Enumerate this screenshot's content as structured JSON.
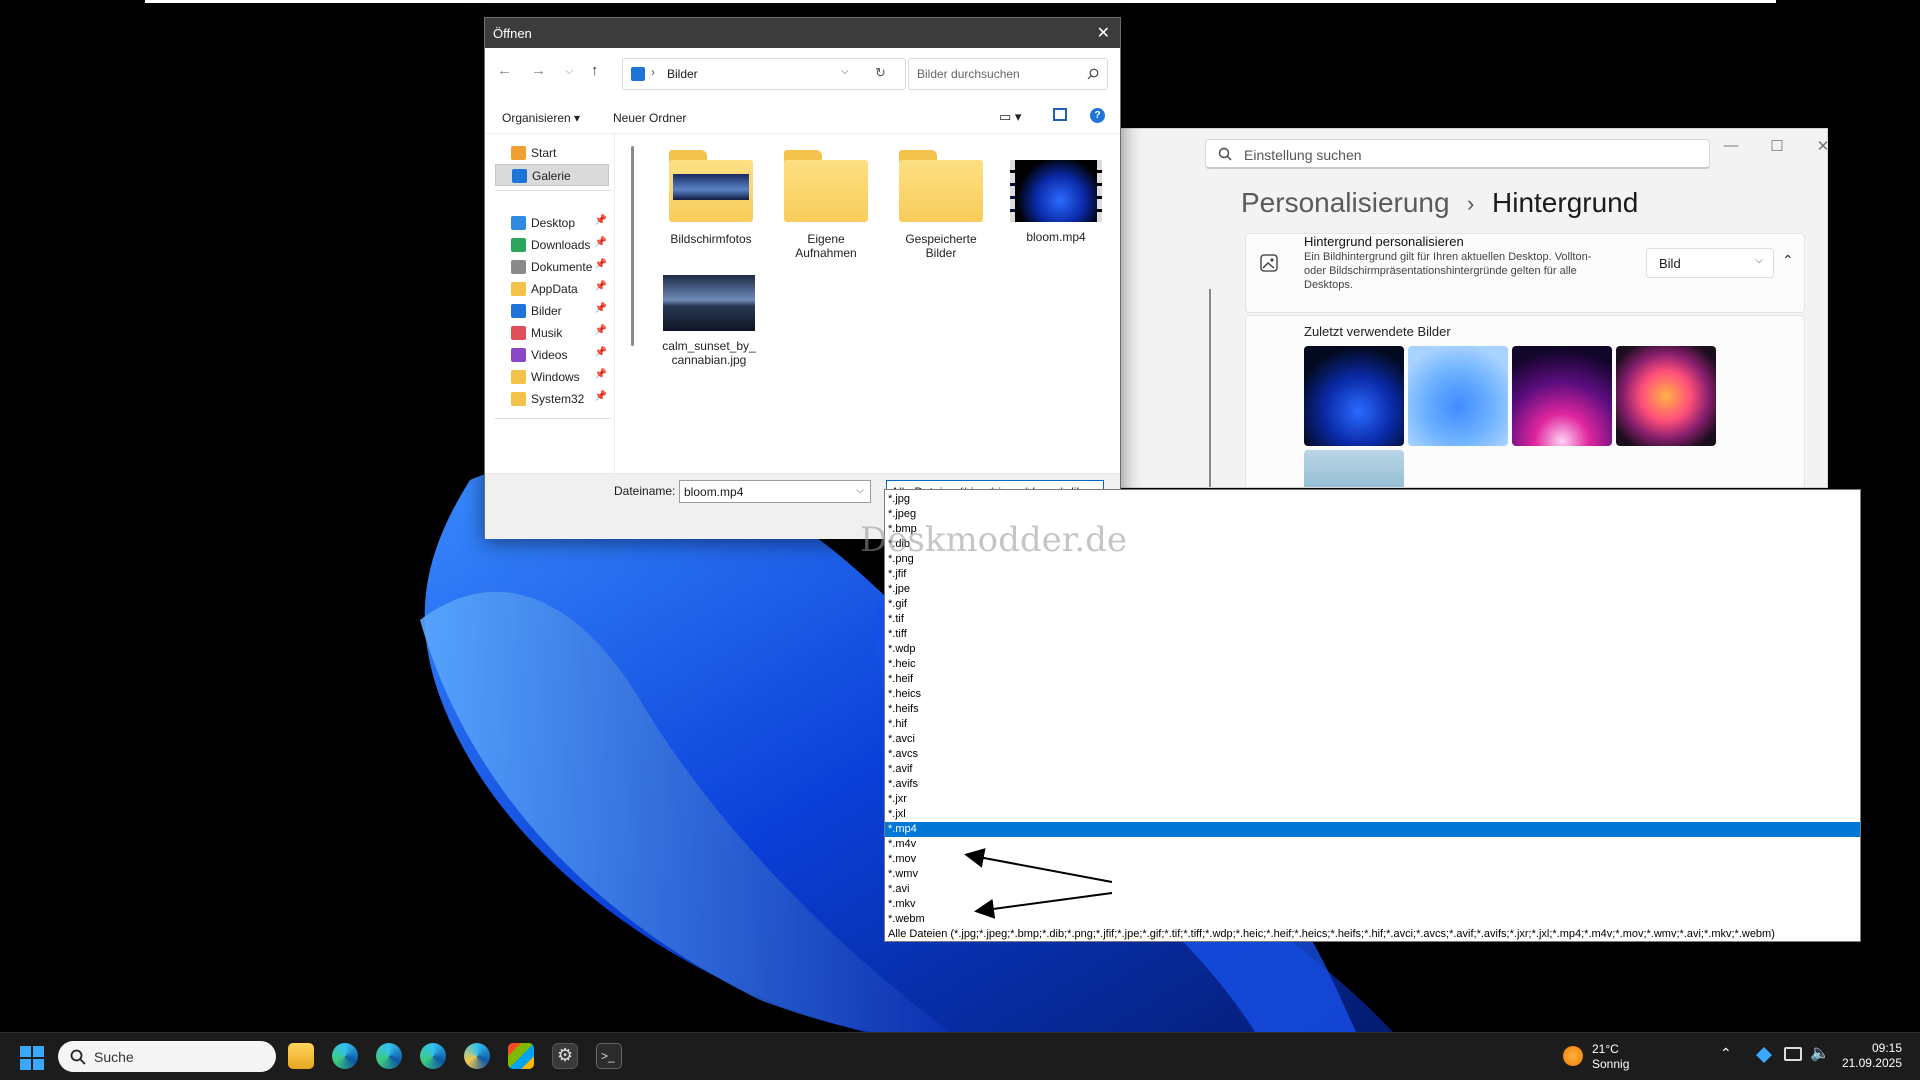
{
  "dialog": {
    "title": "Öffnen",
    "address": "Bilder",
    "search_placeholder": "Bilder durchsuchen",
    "commands": {
      "organize": "Organisieren",
      "new_folder": "Neuer Ordner"
    },
    "nav_items": [
      {
        "label": "Start",
        "icon": "home-icon"
      },
      {
        "label": "Galerie",
        "icon": "gallery-icon",
        "selected": true
      },
      {
        "label": "Desktop",
        "icon": "desktop-icon",
        "pinned": true
      },
      {
        "label": "Downloads",
        "icon": "download-icon",
        "pinned": true
      },
      {
        "label": "Dokumente",
        "icon": "documents-icon",
        "pinned": true
      },
      {
        "label": "AppData",
        "icon": "folder-icon",
        "pinned": true
      },
      {
        "label": "Bilder",
        "icon": "pictures-icon",
        "pinned": true
      },
      {
        "label": "Musik",
        "icon": "music-icon",
        "pinned": true
      },
      {
        "label": "Videos",
        "icon": "videos-icon",
        "pinned": true
      },
      {
        "label": "Windows",
        "icon": "folder-icon",
        "pinned": true
      },
      {
        "label": "System32",
        "icon": "folder-icon",
        "pinned": true
      }
    ],
    "files": [
      {
        "label": "Bildschirmfotos",
        "kind": "folder-image"
      },
      {
        "label": "Eigene Aufnahmen",
        "kind": "folder"
      },
      {
        "label": "Gespeicherte Bilder",
        "kind": "folder"
      },
      {
        "label": "bloom.mp4",
        "kind": "video"
      },
      {
        "label": "calm_sunset_by_ cannabian.jpg",
        "kind": "image"
      }
    ],
    "filename_label": "Dateiname:",
    "filename_value": "bloom.mp4",
    "filetype_value": "Alle Dateien (*.jpg;*.jpeg;*.bmp;*.dib;"
  },
  "filetype_options": [
    "*.jpg",
    "*.jpeg",
    "*.bmp",
    "*.dib",
    "*.png",
    "*.jfif",
    "*.jpe",
    "*.gif",
    "*.tif",
    "*.tiff",
    "*.wdp",
    "*.heic",
    "*.heif",
    "*.heics",
    "*.heifs",
    "*.hif",
    "*.avci",
    "*.avcs",
    "*.avif",
    "*.avifs",
    "*.jxr",
    "*.jxl",
    "*.mp4",
    "*.m4v",
    "*.mov",
    "*.wmv",
    "*.avi",
    "*.mkv",
    "*.webm",
    "Alle Dateien (*.jpg;*.jpeg;*.bmp;*.dib;*.png;*.jfif;*.jpe;*.gif;*.tif;*.tiff;*.wdp;*.heic;*.heif;*.heics;*.heifs;*.hif;*.avci;*.avcs;*.avif;*.avifs;*.jxr;*.jxl;*.mp4;*.m4v;*.mov;*.wmv;*.avi;*.mkv;*.webm)"
  ],
  "filetype_selected": "*.mp4",
  "watermark": "Deskmodder.de",
  "settings": {
    "search_placeholder": "Einstellung suchen",
    "breadcrumb_parent": "Personalisierung",
    "breadcrumb_current": "Hintergrund",
    "card_title": "Hintergrund personalisieren",
    "card_desc": "Ein Bildhintergrund gilt für Ihren aktuellen Desktop. Vollton- oder Bildschirmpräsentationshintergründe gelten für alle Desktops.",
    "card_select": "Bild",
    "recent_title": "Zuletzt verwendete Bilder"
  },
  "taskbar": {
    "search": "Suche",
    "weather_temp": "21°C",
    "weather_text": "Sonnig",
    "time": "09:15",
    "date": "21.09.2025"
  },
  "colors": {
    "accent": "#0078d7",
    "taskbar": "#1c1c1c"
  }
}
